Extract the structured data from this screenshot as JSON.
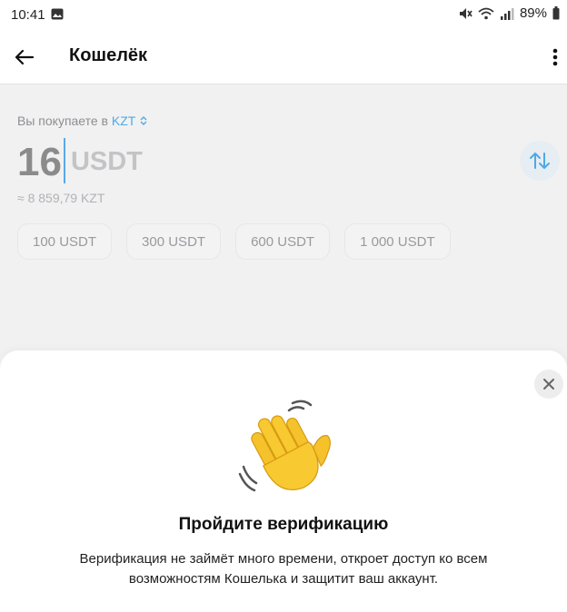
{
  "status_bar": {
    "time": "10:41",
    "battery": "89%",
    "icons": [
      "gallery-icon",
      "mute-icon",
      "wifi-icon",
      "signal-icon",
      "battery-icon"
    ]
  },
  "app_bar": {
    "title": "Кошелёк",
    "icons": [
      "back-arrow-icon",
      "more-vertical-icon"
    ]
  },
  "purchase": {
    "label": "Вы покупаете в",
    "currency": "KZT",
    "amount": "16",
    "unit": "USDT",
    "approx": "≈ 8 859,79 KZT",
    "presets": [
      "100 USDT",
      "300 USDT",
      "600 USDT",
      "1 000 USDT"
    ],
    "accent_color": "#4ea9e6"
  },
  "sheet": {
    "title": "Пройдите верификацию",
    "text_line1": "Верификация не займёт много времени, откроет доступ ко всем",
    "text_line2": "возможностям Кошелька и защитит ваш аккаунт.",
    "icons": [
      "close-icon",
      "waving-hand-icon"
    ]
  }
}
